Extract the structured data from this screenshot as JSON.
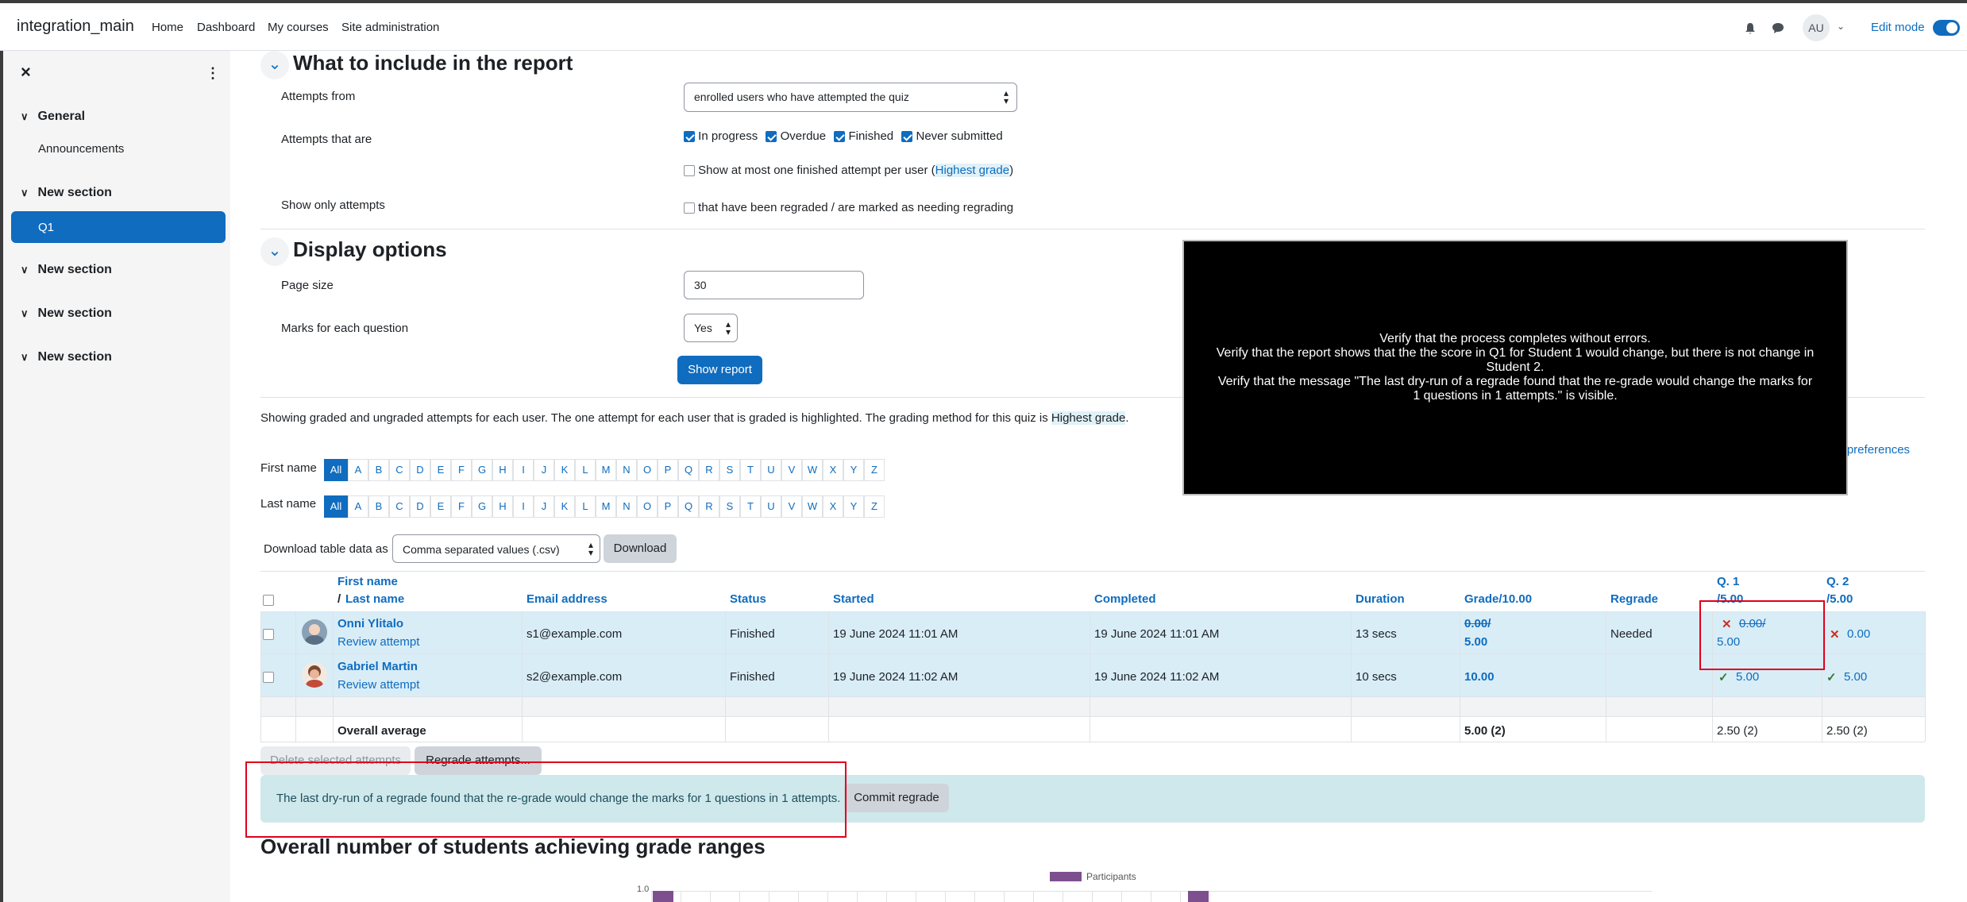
{
  "topbar": {
    "site_name": "integration_main",
    "nav": [
      "Home",
      "Dashboard",
      "My courses",
      "Site administration"
    ],
    "avatar_initials": "AU",
    "edit_mode_label": "Edit mode"
  },
  "sidebar": {
    "close": "×",
    "more": "⋮",
    "sections": [
      {
        "title": "General",
        "items": [
          "Announcements"
        ]
      },
      {
        "title": "New section",
        "items": [
          "Q1"
        ]
      },
      {
        "title": "New section",
        "items": []
      },
      {
        "title": "New section",
        "items": []
      },
      {
        "title": "New section",
        "items": []
      }
    ]
  },
  "report_include": {
    "heading": "What to include in the report",
    "attempts_from_label": "Attempts from",
    "attempts_from_value": "enrolled users who have attempted the quiz",
    "attempts_that_are_label": "Attempts that are",
    "states": [
      "In progress",
      "Overdue",
      "Finished",
      "Never submitted"
    ],
    "one_attempt_prefix": "Show at most one finished attempt per user (",
    "one_attempt_link": "Highest grade",
    "one_attempt_suffix": ")",
    "show_only_label": "Show only attempts",
    "regraded_label": "that have been regraded / are marked as needing regrading"
  },
  "display_options": {
    "heading": "Display options",
    "page_size_label": "Page size",
    "page_size_value": "30",
    "marks_label": "Marks for each question",
    "marks_value": "Yes",
    "show_report": "Show report"
  },
  "overlay": {
    "line1": "Verify that the process completes without errors.",
    "line2": "Verify that the report shows that the the score in Q1 for Student 1 would change, but there is not change in Student 2.",
    "line3": "Verify that the message \"The last dry-run of a regrade found that the re-grade would change the marks for 1 questions in 1 attempts.\" is visible."
  },
  "info": {
    "text": "Showing graded and ungraded attempts for each user. The one attempt for each user that is graded is highlighted. The grading method for this quiz is",
    "method": "Highest grade",
    "period": ".",
    "prefs_link": "le preferences"
  },
  "filters": {
    "first_name_label": "First name",
    "last_name_label": "Last name",
    "letters": [
      "All",
      "A",
      "B",
      "C",
      "D",
      "E",
      "F",
      "G",
      "H",
      "I",
      "J",
      "K",
      "L",
      "M",
      "N",
      "O",
      "P",
      "Q",
      "R",
      "S",
      "T",
      "U",
      "V",
      "W",
      "X",
      "Y",
      "Z"
    ]
  },
  "download": {
    "label": "Download table data as",
    "format": "Comma separated values (.csv)",
    "button": "Download"
  },
  "table": {
    "headers": {
      "first_name": "First name",
      "slash": "/",
      "last_name": "Last name",
      "email": "Email address",
      "status": "Status",
      "started": "Started",
      "completed": "Completed",
      "duration": "Duration",
      "grade": "Grade/10.00",
      "regrade": "Regrade",
      "q1": "Q. 1",
      "q1_max": "/5.00",
      "q2": "Q. 2",
      "q2_max": "/5.00"
    },
    "rows": [
      {
        "name": "Onni Ylitalo",
        "review": "Review attempt",
        "email": "s1@example.com",
        "status": "Finished",
        "started": "19 June 2024 11:01 AM",
        "completed": "19 June 2024 11:01 AM",
        "duration": "13 secs",
        "grade_old": "0.00/",
        "grade_new": "5.00",
        "regrade": "Needed",
        "q1_old": "0.00/",
        "q1_new": "5.00",
        "q2": "0.00"
      },
      {
        "name": "Gabriel Martin",
        "review": "Review attempt",
        "email": "s2@example.com",
        "status": "Finished",
        "started": "19 June 2024 11:02 AM",
        "completed": "19 June 2024 11:02 AM",
        "duration": "10 secs",
        "grade": "10.00",
        "q1": "5.00",
        "q2": "5.00"
      }
    ],
    "average": {
      "label": "Overall average",
      "grade": "5.00 (2)",
      "q1": "2.50 (2)",
      "q2": "2.50 (2)"
    }
  },
  "actions": {
    "delete": "Delete selected attempts",
    "regrade": "Regrade attempts..."
  },
  "alert": {
    "text": "The last dry-run of a regrade found that the re-grade would change the marks for 1 questions in 1 attempts.",
    "button": "Commit regrade"
  },
  "chart": {
    "heading": "Overall number of students achieving grade ranges",
    "legend": "Participants",
    "y_top_tick": "1.0"
  },
  "colors": {
    "accent": "#0f6cbf",
    "highlight_row": "#d9edf7",
    "alert_bg": "#cfe8ec",
    "annotation_red": "#e0001b",
    "bar": "#7e4f8e"
  }
}
